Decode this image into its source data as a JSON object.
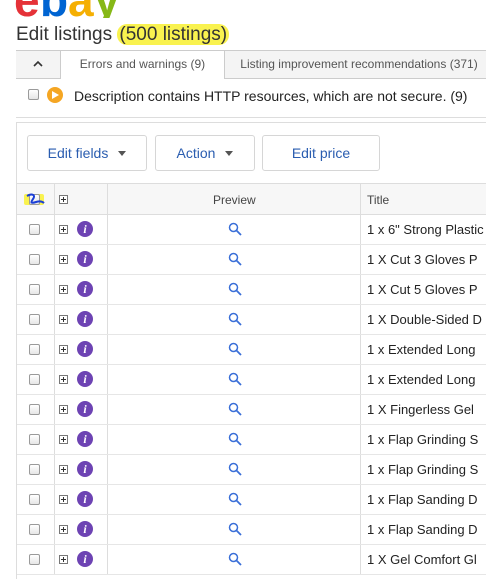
{
  "header": {
    "page_title": "Edit listings",
    "listing_count": "(500 listings)"
  },
  "tabs": [
    {
      "label": "Errors and warnings (9)",
      "active": true
    },
    {
      "label": "Listing improvement recommendations (371)",
      "active": false
    }
  ],
  "notice": {
    "message": "Description contains HTTP resources, which are not secure. (9)"
  },
  "toolbar": {
    "edit_fields": "Edit fields",
    "action": "Action",
    "edit_price": "Edit price"
  },
  "table": {
    "columns": {
      "preview": "Preview",
      "title": "Title"
    },
    "info_glyph": "i",
    "rows": [
      {
        "title": "1 x 6\" Strong Plastic"
      },
      {
        "title": "1 X Cut 3 Gloves P"
      },
      {
        "title": "1 X Cut 5 Gloves P"
      },
      {
        "title": "1 X Double-Sided D"
      },
      {
        "title": "1 x Extended Long"
      },
      {
        "title": "1 x Extended Long"
      },
      {
        "title": "1 X Fingerless Gel"
      },
      {
        "title": "1 x Flap Grinding S"
      },
      {
        "title": "1 x Flap Grinding S"
      },
      {
        "title": "1 x Flap Sanding D"
      },
      {
        "title": "1 x Flap Sanding D"
      },
      {
        "title": "1 X Gel Comfort Gl"
      }
    ]
  },
  "colors": {
    "highlight": "#f9f24f",
    "link_blue": "#2a5db0",
    "warning_orange": "#f5a623",
    "info_purple": "#6d43b3",
    "annotation_blue": "#1b3fd6"
  },
  "icons": {
    "collapse": "chevron-up-icon",
    "warning": "play-warning-icon",
    "expand": "plus-box-icon",
    "info": "info-icon",
    "preview": "magnifier-icon"
  }
}
